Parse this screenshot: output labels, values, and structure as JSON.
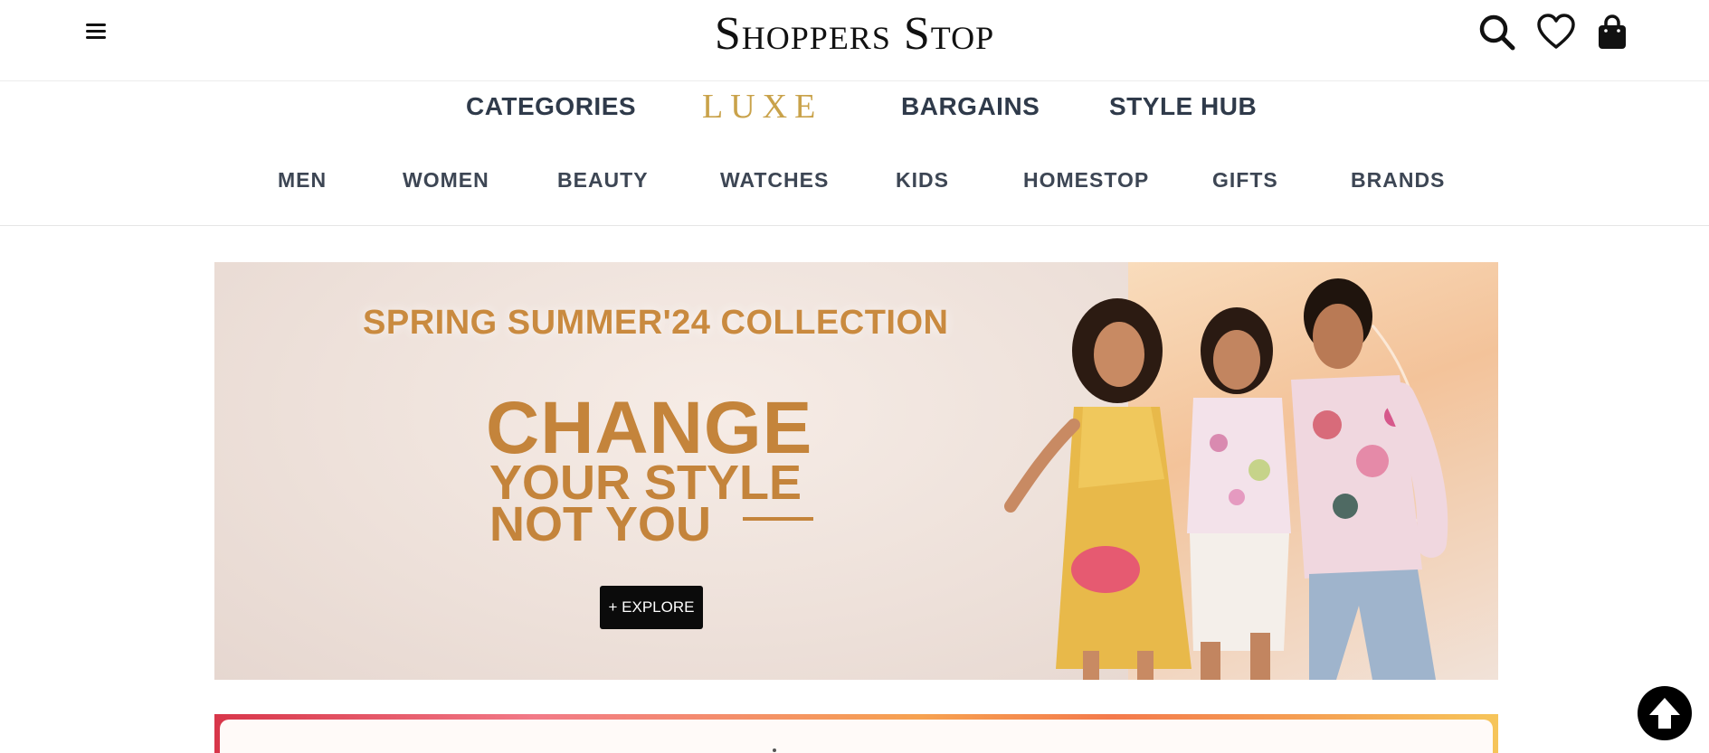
{
  "header": {
    "brand_logo": "Shoppers Stop",
    "menu_icon": "hamburger-menu-icon",
    "search_icon": "search-icon",
    "wishlist_icon": "heart-icon",
    "bag_icon": "shopping-bag-icon"
  },
  "primary_nav": {
    "categories": "CATEGORIES",
    "luxe": "LUXE",
    "bargains": "BARGAINS",
    "style_hub": "STYLE HUB"
  },
  "category_nav": [
    "MEN",
    "WOMEN",
    "BEAUTY",
    "WATCHES",
    "KIDS",
    "HOMESTOP",
    "GIFTS",
    "BRANDS"
  ],
  "hero": {
    "collection": "SPRING SUMMER'24 COLLECTION",
    "line1": "CHANGE",
    "line2": "YOUR STYLE",
    "line3": "NOT YOU",
    "cta": "+ EXPLORE"
  },
  "back_to_top_icon": "arrow-up-icon",
  "colors": {
    "nav_text": "#2f3a4a",
    "luxe_gold": "#c9a24a",
    "hero_text": "#c4843b",
    "cta_bg": "#0b0b0b"
  }
}
